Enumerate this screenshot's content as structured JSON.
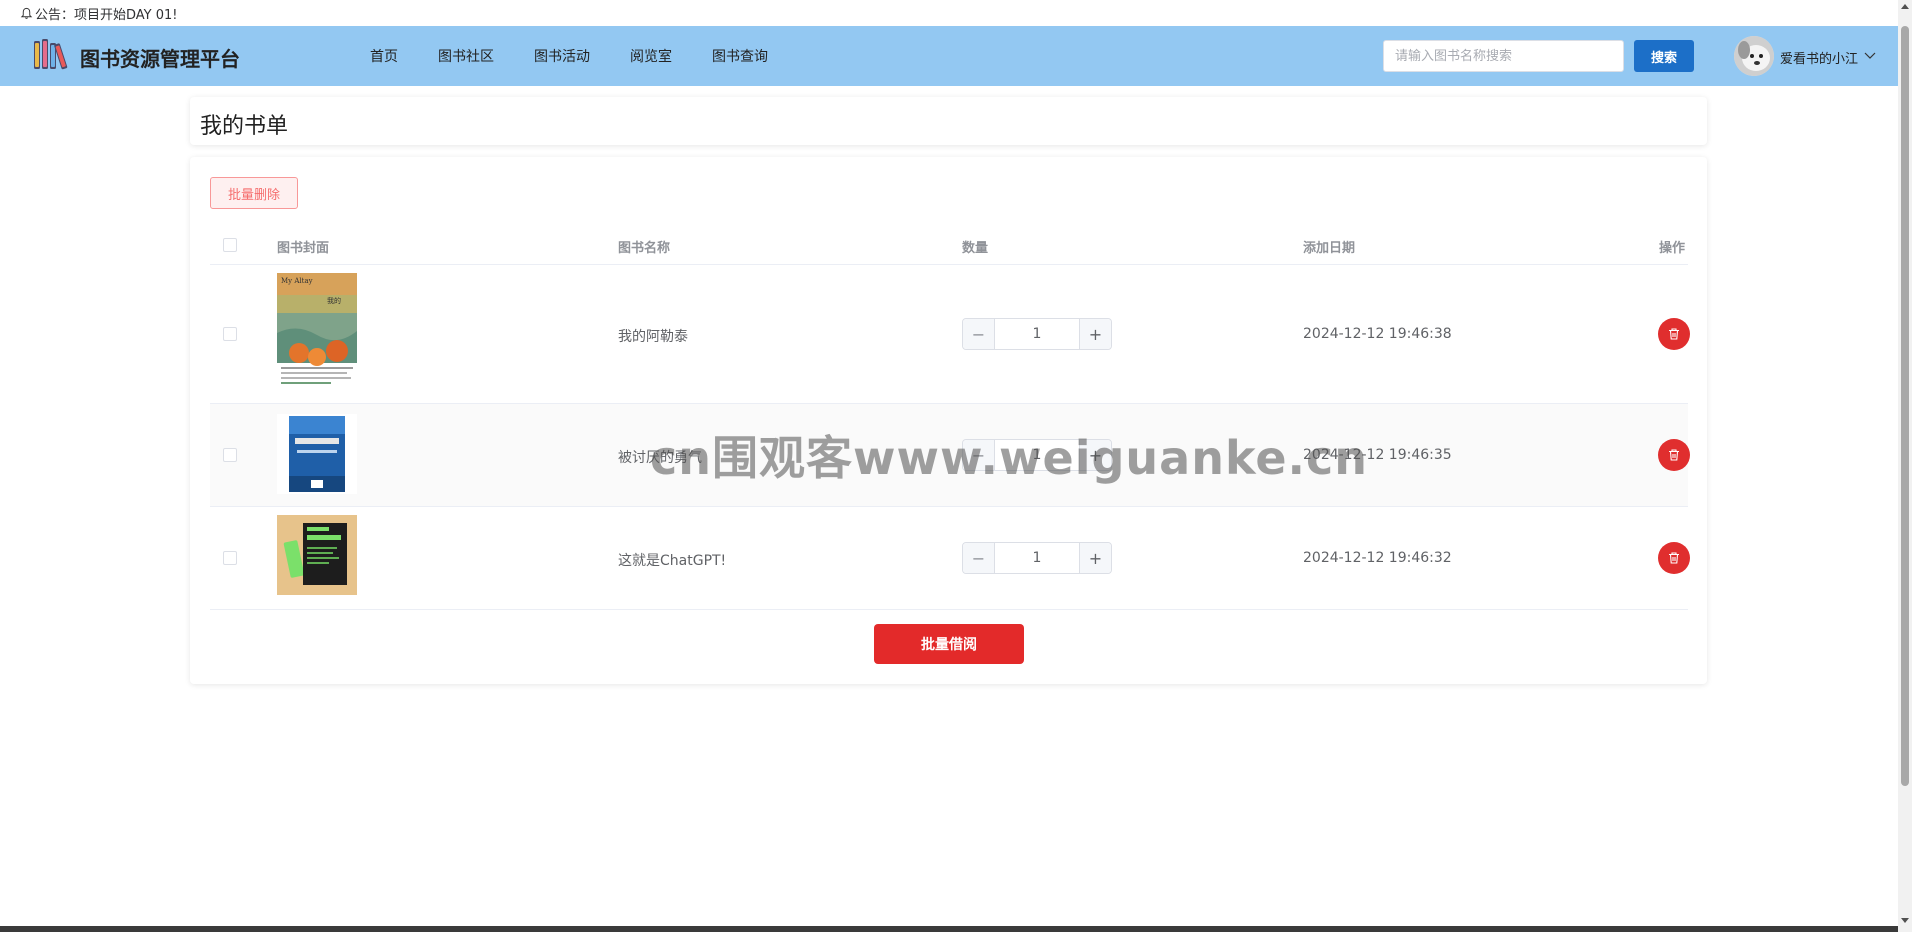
{
  "notice": {
    "icon": "bell-icon",
    "text": "公告：项目开始DAY 01!"
  },
  "header": {
    "brand": "图书资源管理平台",
    "nav": [
      "首页",
      "图书社区",
      "图书活动",
      "阅览室",
      "图书查询"
    ],
    "search": {
      "placeholder": "请输入图书名称搜索",
      "value": "",
      "button": "搜索"
    },
    "user": {
      "name": "爱看书的小江",
      "avatar_icon": "dog-avatar-icon"
    },
    "colors": {
      "header_bg": "#93c8f2",
      "primary": "#1c6fc8",
      "danger": "#e32a2a"
    }
  },
  "page": {
    "title": "我的书单",
    "batch_delete": "批量删除",
    "batch_borrow": "批量借阅",
    "columns": [
      "图书封面",
      "图书名称",
      "数量",
      "添加日期",
      "操作"
    ],
    "rows": [
      {
        "cover_icon": "book-cover-my-altay",
        "name": "我的阿勒泰",
        "quantity": "1",
        "date": "2024-12-12 19:46:38"
      },
      {
        "cover_icon": "book-cover-blue",
        "name": "被讨厌的勇气",
        "quantity": "1",
        "date": "2024-12-12 19:46:35"
      },
      {
        "cover_icon": "book-cover-chatgpt",
        "name": "这就是ChatGPT!",
        "quantity": "1",
        "date": "2024-12-12 19:46:32"
      }
    ]
  },
  "watermark": "cn围观客www.weiguanke.cn"
}
